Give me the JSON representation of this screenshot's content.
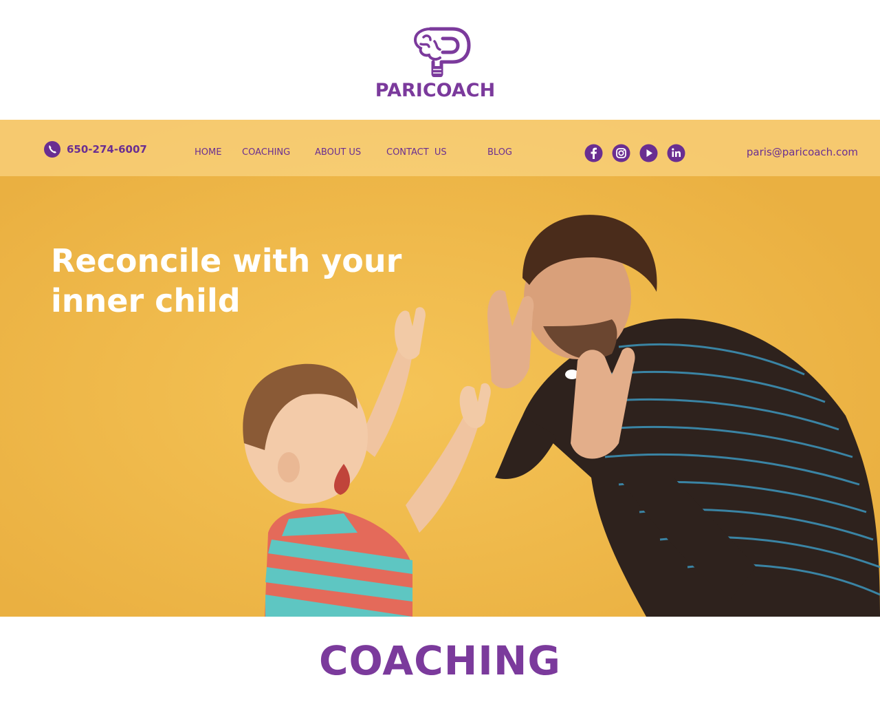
{
  "brand": {
    "name": "PARICOACH",
    "logo_icon": "brain-lightbulb-p-icon",
    "color": "#7b3a9c"
  },
  "nav": {
    "phone": "650-274-6007",
    "phone_icon": "phone-icon",
    "items": [
      "HOME",
      "COACHING",
      "ABOUT US",
      "CONTACT  US",
      "BLOG"
    ],
    "social": [
      "facebook-icon",
      "instagram-icon",
      "youtube-icon",
      "linkedin-icon"
    ],
    "email": "paris@paricoach.com",
    "color": "#6a2e91"
  },
  "hero": {
    "headline_line1": "Reconcile with your",
    "headline_line2": "inner child",
    "background": "#f1b94a"
  },
  "section": {
    "title": "COACHING"
  }
}
